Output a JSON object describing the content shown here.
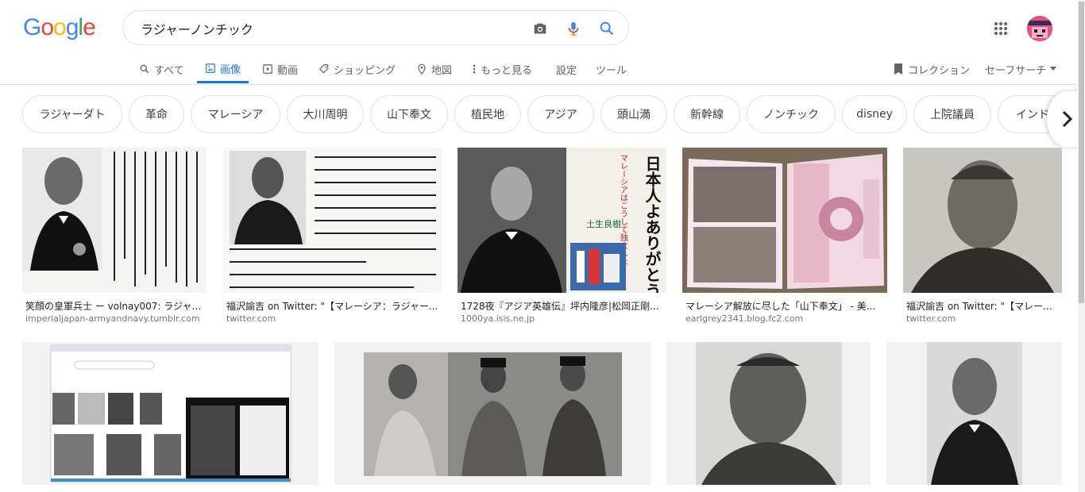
{
  "logo": [
    "G",
    "o",
    "o",
    "g",
    "l",
    "e"
  ],
  "search": {
    "query": "ラジャーノンチック"
  },
  "tabs": [
    {
      "label": "すべて",
      "icon": "search-icon",
      "active": false
    },
    {
      "label": "画像",
      "icon": "image-icon",
      "active": true
    },
    {
      "label": "動画",
      "icon": "video-icon",
      "active": false
    },
    {
      "label": "ショッピング",
      "icon": "tag-icon",
      "active": false
    },
    {
      "label": "地図",
      "icon": "map-pin-icon",
      "active": false
    },
    {
      "label": "もっと見る",
      "icon": "more-vert-icon",
      "active": false
    },
    {
      "label": "設定",
      "icon": "",
      "active": false
    },
    {
      "label": "ツール",
      "icon": "",
      "active": false
    }
  ],
  "right_tools": {
    "collection": "コレクション",
    "safesearch": "セーフサーチ"
  },
  "chips": [
    "ラジャーダト",
    "革命",
    "マレーシア",
    "大川周明",
    "山下奉文",
    "植民地",
    "アジア",
    "頭山満",
    "新幹線",
    "ノンチック",
    "disney",
    "上院議員",
    "インド"
  ],
  "results_row1": [
    {
      "caption": "笑顔の皇軍兵士 ー volnay007: ラジャー...",
      "source": "imperialjapan-armyandnavy.tumblr.com"
    },
    {
      "caption": "福沢諭吉 on Twitter: \"【マレーシア：ラジャー...",
      "source": "twitter.com"
    },
    {
      "caption": "1728夜『アジア英雄伝』坪内隆彦|松岡正剛...",
      "source": "1000ya.isis.ne.jp"
    },
    {
      "caption": "マレーシア解放に尽した「山下奉文」 - 美...",
      "source": "earlgrey2341.blog.fc2.com"
    },
    {
      "caption": "福沢諭吉 on Twitter: \"【マレーシ...",
      "source": "twitter.com"
    }
  ],
  "image_text": {
    "book_title": "日本人よありがとう",
    "book_sub": "マレーシアはこうして独立した",
    "book_author": "土生良樹"
  },
  "colors": {
    "accent": "#1a73e8",
    "text": "#202124",
    "muted": "#70757a",
    "border": "#dfe1e5"
  }
}
